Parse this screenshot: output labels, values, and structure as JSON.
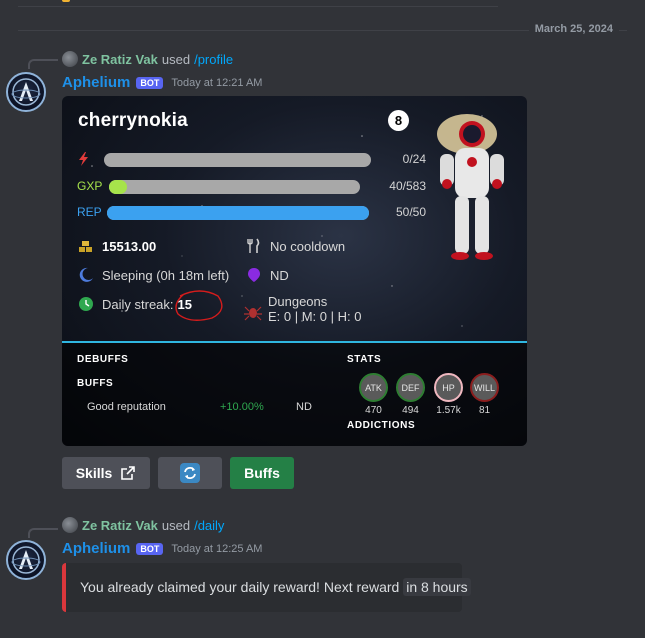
{
  "date_divider": "March 25, 2024",
  "messages": [
    {
      "reply_user": "Ze Ratiz Vak",
      "reply_used": "used",
      "reply_command": "/profile",
      "author": "Aphelium",
      "bot_tag": "BOT",
      "timestamp": "Today at 12:21 AM"
    },
    {
      "reply_user": "Ze Ratiz Vak",
      "reply_used": "used",
      "reply_command": "/daily",
      "author": "Aphelium",
      "bot_tag": "BOT",
      "timestamp": "Today at 12:25 AM"
    }
  ],
  "profile": {
    "username": "cherrynokia",
    "level": "8",
    "bars": [
      {
        "label": "",
        "icon": "lightning-icon",
        "value_text": "0/24",
        "fraction": 0.0,
        "color": "#e23b3b"
      },
      {
        "label": "GXP",
        "icon": "",
        "value_text": "40/583",
        "fraction": 0.07,
        "color": "#a6e34b"
      },
      {
        "label": "REP",
        "icon": "",
        "value_text": "50/50",
        "fraction": 1.0,
        "color": "#3ba1f0"
      }
    ],
    "gold": "15513.00",
    "cooldown": "No cooldown",
    "sleep": "Sleeping (0h 18m left)",
    "location": "ND",
    "streak_label": "Daily streak:",
    "streak_value": "15",
    "dungeons_title": "Dungeons",
    "dungeons_detail": "E: 0 | M: 0 | H: 0",
    "debuffs_title": "DEBUFFS",
    "buffs_title": "BUFFS",
    "buff": {
      "name": "Good reputation",
      "percent": "+10.00%",
      "duration": "ND"
    },
    "stats_title": "STATS",
    "addictions_title": "ADDICTIONS",
    "stats": [
      {
        "label": "ATK",
        "value": "470",
        "ring": "#2e7d32"
      },
      {
        "label": "DEF",
        "value": "494",
        "ring": "#2e7d32"
      },
      {
        "label": "HP",
        "value": "1.57k",
        "ring": "#f0b8c0"
      },
      {
        "label": "WILL",
        "value": "81",
        "ring": "#8b1e1e"
      }
    ]
  },
  "buttons": {
    "skills": "Skills",
    "buffs": "Buffs"
  },
  "daily": {
    "message": "You already claimed your daily reward! Next reward",
    "highlight": "in 8 hours"
  },
  "colors": {
    "background": "#313338",
    "bot_badge": "#5865f2",
    "author_name": "#1e90e8",
    "button_green": "#248046",
    "notice_border": "#da373c"
  }
}
